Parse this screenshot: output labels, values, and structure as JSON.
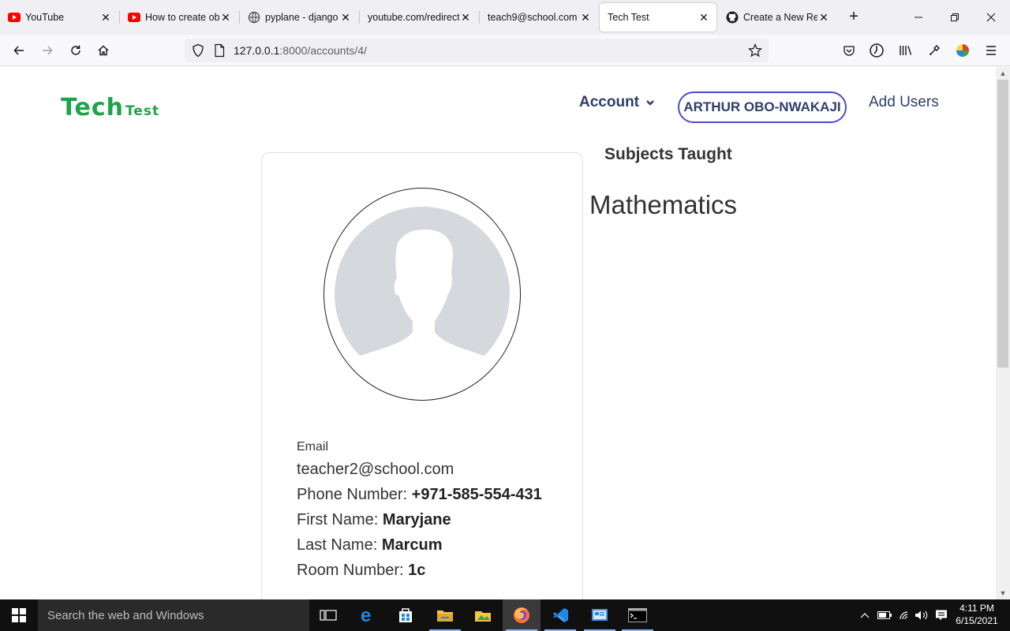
{
  "browser": {
    "tabs": [
      {
        "title": "YouTube",
        "icon": "youtube-icon",
        "active": false
      },
      {
        "title": "How to create obj",
        "icon": "youtube-icon",
        "active": false
      },
      {
        "title": "pyplane - django",
        "icon": "globe-icon",
        "active": false
      },
      {
        "title": "youtube.com/redirect",
        "icon": "none",
        "active": false
      },
      {
        "title": "teach9@school.com |",
        "icon": "none",
        "active": false
      },
      {
        "title": "Tech Test",
        "icon": "none",
        "active": true
      },
      {
        "title": "Create a New Rep",
        "icon": "github-icon",
        "active": false
      }
    ],
    "url_host": "127.0.0.1",
    "url_path": ":8000/accounts/4/"
  },
  "site": {
    "logo_main": "Tech",
    "logo_sub": "Test",
    "nav_account": "Account",
    "nav_user": "ARTHUR OBO-NWAKAJI",
    "nav_add_users": "Add Users"
  },
  "profile": {
    "email_label": "Email",
    "email": "teacher2@school.com",
    "phone_label": "Phone Number:",
    "phone": "+971-585-554-431",
    "first_name_label": "First Name:",
    "first_name": "Maryjane",
    "last_name_label": "Last Name:",
    "last_name": "Marcum",
    "room_label": "Room Number:",
    "room": "1c"
  },
  "subjects": {
    "title": "Subjects Taught",
    "items": [
      "Mathematics"
    ]
  },
  "taskbar": {
    "search_placeholder": "Search the web and Windows",
    "time": "4:11 PM",
    "date": "6/15/2021"
  },
  "colors": {
    "brand_green": "#1ea34a",
    "nav_text": "#2c3e6e",
    "user_pill_border": "#4c4cc8"
  }
}
